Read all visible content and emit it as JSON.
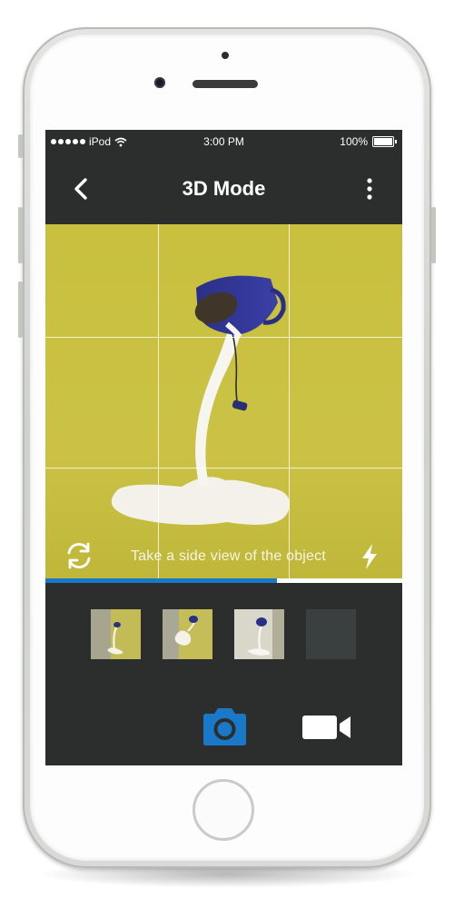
{
  "status_bar": {
    "carrier": "iPod",
    "time": "3:00 PM",
    "battery": "100%"
  },
  "nav": {
    "title": "3D Mode",
    "back_icon": "chevron-left-icon",
    "menu_icon": "more-vertical-icon"
  },
  "viewfinder": {
    "hint": "Take a side view of the object",
    "left_icon": "switch-camera-icon",
    "right_icon": "flash-icon",
    "progress": 0.65
  },
  "thumbnails": [
    {
      "state": "captured"
    },
    {
      "state": "captured"
    },
    {
      "state": "captured"
    },
    {
      "state": "empty"
    }
  ],
  "modes": {
    "photo_icon": "camera-icon",
    "video_icon": "video-camera-icon",
    "active": "photo"
  },
  "colors": {
    "accent": "#1a78c9",
    "screen_bg": "#2c2e2d",
    "viewfinder_bg": "#c5bd3e"
  }
}
